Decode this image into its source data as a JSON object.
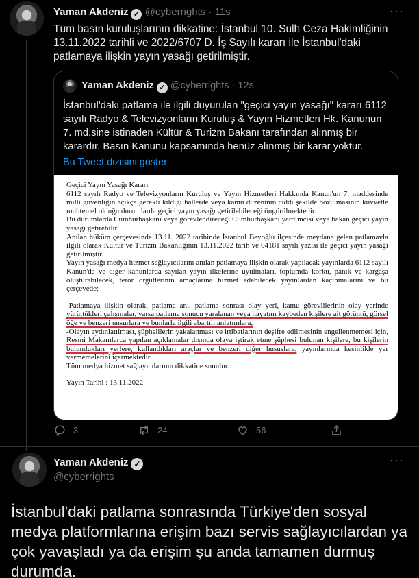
{
  "tweet1": {
    "name": "Yaman Akdeniz",
    "handle": "@cyberrights",
    "time": "11s",
    "text": "Tüm basın kuruluşlarının dikkatine: İstanbul 10. Sulh Ceza Hakimliğinin 13.11.2022 tarihli ve 2022/6707 D. İş Sayılı kararı ile İstanbul'daki patlamaya ilişkin yayın yasağı getirilmiştir.",
    "more_icon": "more-horizontal-icon"
  },
  "quote": {
    "name": "Yaman Akdeniz",
    "handle": "@cyberrights",
    "time": "12s",
    "text": "İstanbul'daki patlama ile ilgili duyurulan \"geçici yayın yasağı\" kararı 6112 sayılı Radyo & Televizyonların Kuruluş & Yayın Hizmetleri Hk. Kanunun 7. md.sine istinaden Kültür & Turizm Bakanı tarafından alınmış bir karardır. Basın Kanunu kapsamında henüz alınmış bir karar yoktur.",
    "thread_link": "Bu Tweet dizisini göster"
  },
  "document": {
    "title": "Geçici Yayın Yasağı Kararı",
    "p1": "6112 sayılı Radyo ve Televizyonların Kuruluş ve Yayın Hizmetleri Hakkında Kanun'un 7. maddesinde milli güvenliğin açıkça gerekli kıldığı hallerde veya kamu düzeninin ciddi şekilde bozulmasının kuvvetle muhtemel olduğu durumlarda geçici yayın yasağı getirilebileceği öngörülmektedir.",
    "p2": "Bu durumlarda Cumhurbaşkanı veya görevlendireceği Cumhurbaşkanı yardımcısı veya bakan geçici yayın yasağı getirebilir.",
    "p3": "Anılan hüküm çerçevesinde 13.11. 2022 tarihinde İstanbul Beyoğlu ilçesinde meydana gelen patlamayla ilgili olarak Kültür ve Turizm Bakanlığının 13.11.2022 tarih ve 04181 sayılı yazısı ile geçici yayın yasağı getirilmiştir.",
    "p4": "Yayın yasağı medya hizmet sağlayıcılarını anılan patlamaya ilişkin olarak yapılacak yayınlarda 6112 sayılı Kanun'da ve diğer kanunlarda sayılan yayın ilkelerine uyulmaları, toplumda korku, panik ve kargaşa oluşturabilecek, terör örgütlerinin amaçlarına hizmet edebilecek yayınlardan kaçınmalarını ve bu çerçevede;",
    "b1_a": "-Patlamaya ilişkin olarak, patlama anı, patlama sonrası olay yeri, kamu görevlilerinin olay yerinde ",
    "b1_u": "yürüttükleri çalışmalar, varsa patlama sonucu yaralanan veya hayatını kaybeden kişilere ait görüntü, görsel öğe ve benzeri unsurlara ve bunlarla ilgili abartılı anlatımlara,",
    "b2_a": "-Olayın aydınlatılması, şüphelilerin yakalanması ve irtibatlarının deşifre edilmesinin engellenmemesi için, ",
    "b2_u1": "Resmi Makamlarca yapılan açıklamalar dışında olaya iştirak etme şüphesi bulunan kişilere, bu kişilerin bulundukları yerlere, kullandıkları araçlar ve benzeri diğer hususlara,",
    "b2_c": " yayınlarında kesinlikle yer vermemelerini içermektedir.",
    "p5": "Tüm medya hizmet sağlayıcılarının dikkatine sunulur.",
    "date": "Yayın Tarihi : 13.11.2022"
  },
  "actions": {
    "reply_count": "3",
    "retweet_count": "24",
    "like_count": "56",
    "reply_icon": "reply-icon",
    "retweet_icon": "retweet-icon",
    "like_icon": "heart-icon",
    "share_icon": "share-icon"
  },
  "tweet2": {
    "name": "Yaman Akdeniz",
    "handle": "@cyberrights",
    "text": "İstanbul'daki patlama sonrasında Türkiye'den sosyal medya platformlarına erişim bazı servis sağlayıcılardan ya çok yavaşladı ya da erişim şu anda tamamen durmuş durumda."
  }
}
